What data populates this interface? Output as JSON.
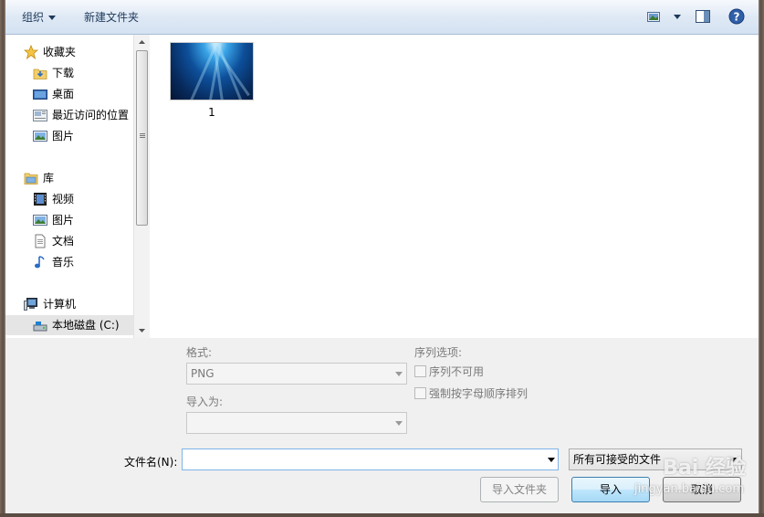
{
  "toolbar": {
    "organize_label": "组织",
    "new_folder_label": "新建文件夹"
  },
  "nav": {
    "favorites": {
      "label": "收藏夹",
      "icon": "star-icon"
    },
    "favorite_items": [
      {
        "label": "下载",
        "icon": "download-folder-icon"
      },
      {
        "label": "桌面",
        "icon": "desktop-icon"
      },
      {
        "label": "最近访问的位置",
        "icon": "recent-places-icon"
      },
      {
        "label": "图片",
        "icon": "pictures-icon"
      }
    ],
    "libraries": {
      "label": "库",
      "icon": "library-icon"
    },
    "library_items": [
      {
        "label": "视频",
        "icon": "video-icon"
      },
      {
        "label": "图片",
        "icon": "pictures-icon"
      },
      {
        "label": "文档",
        "icon": "document-icon"
      },
      {
        "label": "音乐",
        "icon": "music-icon"
      }
    ],
    "computer": {
      "label": "计算机",
      "icon": "computer-icon"
    },
    "computer_items": [
      {
        "label": "本地磁盘 (C:)",
        "icon": "local-disk-icon",
        "selected": true
      }
    ]
  },
  "files": [
    {
      "name": "1"
    }
  ],
  "options": {
    "format_label": "格式:",
    "format_value": "PNG",
    "import_as_label": "导入为:",
    "import_as_value": "",
    "sequence_label": "序列选项:",
    "sequence_unavailable": "序列不可用",
    "force_alpha": "强制按字母顺序排列"
  },
  "footer": {
    "filename_label": "文件名(N):",
    "filename_value": "",
    "filter_value": "所有可接受的文件",
    "import_folder_button": "导入文件夹",
    "import_button": "导入",
    "cancel_button": "取消",
    "watermark": "Bai 经验",
    "watermark_url": "jingyan.baidu.com"
  }
}
